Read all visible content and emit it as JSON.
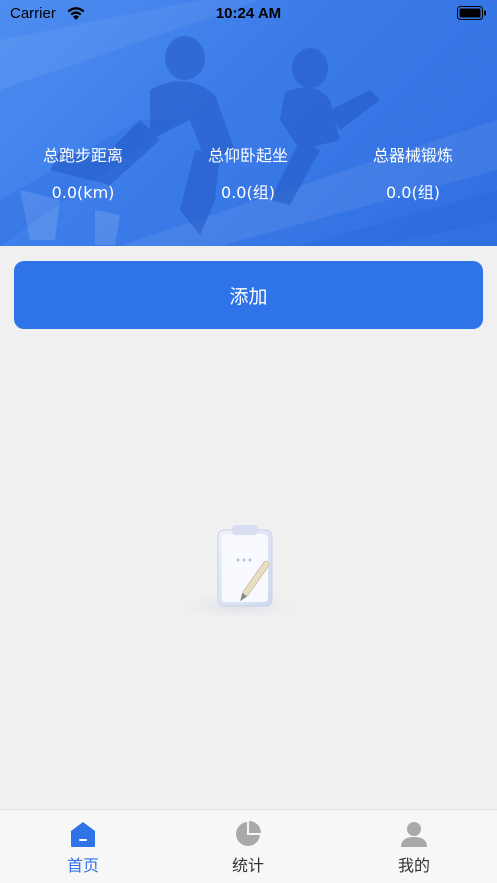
{
  "status_bar": {
    "carrier": "Carrier",
    "time": "10:24 AM"
  },
  "stats": [
    {
      "label": "总跑步距离",
      "value": "0.0(km)"
    },
    {
      "label": "总仰卧起坐",
      "value": "0.0(组)"
    },
    {
      "label": "总器械锻炼",
      "value": "0.0(组)"
    }
  ],
  "add_button": {
    "label": "添加"
  },
  "tabbar": {
    "items": [
      {
        "label": "首页",
        "icon": "home-icon",
        "active": true
      },
      {
        "label": "统计",
        "icon": "pie-chart-icon",
        "active": false
      },
      {
        "label": "我的",
        "icon": "user-icon",
        "active": false
      }
    ]
  },
  "colors": {
    "accent": "#2f73e8",
    "active_tab": "#2f73e8",
    "inactive_tab": "#333333",
    "background": "#f0f0f0"
  }
}
